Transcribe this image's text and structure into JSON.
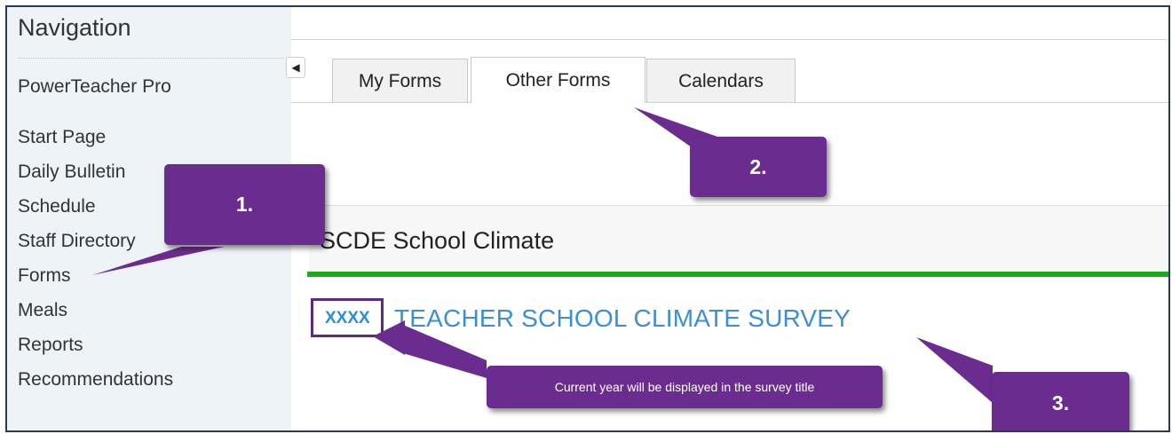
{
  "sidebar": {
    "title": "Navigation",
    "app_name": "PowerTeacher Pro",
    "items": [
      {
        "label": "Start Page"
      },
      {
        "label": "Daily Bulletin"
      },
      {
        "label": "Schedule"
      },
      {
        "label": "Staff Directory"
      },
      {
        "label": "Forms"
      },
      {
        "label": "Meals"
      },
      {
        "label": "Reports"
      },
      {
        "label": "Recommendations"
      }
    ]
  },
  "main": {
    "tabs": [
      {
        "label": "My Forms",
        "active": false
      },
      {
        "label": "Other Forms",
        "active": true
      },
      {
        "label": "Calendars",
        "active": false
      }
    ],
    "section_title": "SCDE School Climate",
    "survey": {
      "year_placeholder": "XXXX",
      "title": "TEACHER SCHOOL CLIMATE SURVEY"
    }
  },
  "annotations": {
    "callout_1": "1.",
    "callout_2": "2.",
    "callout_3": "3.",
    "note": "Current year will be displayed in the survey title"
  },
  "colors": {
    "callout": "#6b2c8f",
    "link": "#3b8fd6",
    "green_bar": "#1aaa1a",
    "sidebar_bg": "#eef3f8"
  }
}
